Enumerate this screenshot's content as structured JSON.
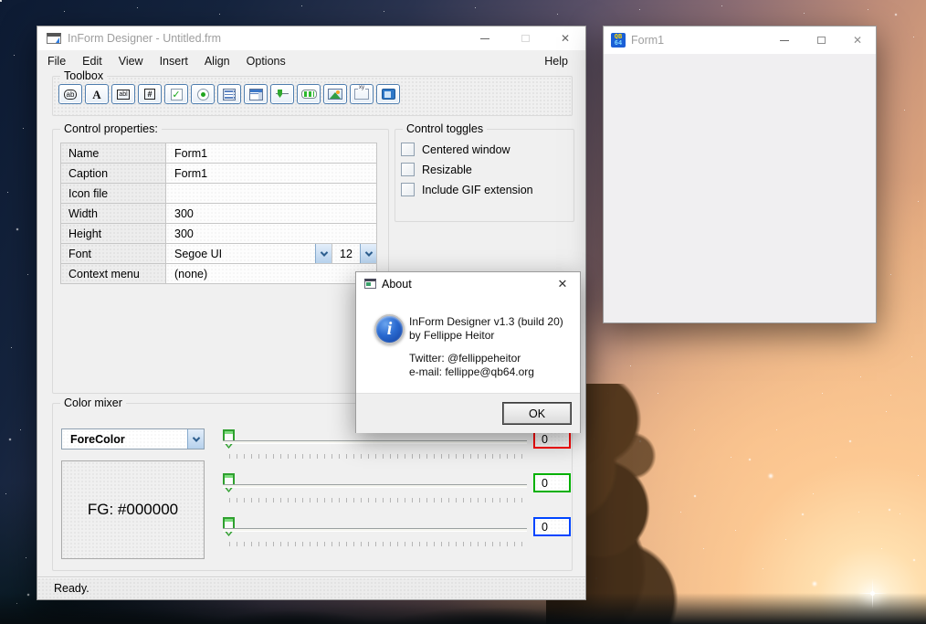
{
  "glyphs": {
    "close": "✕",
    "check": "✓"
  },
  "main_window": {
    "title": "InForm Designer - Untitled.frm",
    "menu": {
      "items": [
        {
          "label": "File"
        },
        {
          "label": "Edit"
        },
        {
          "label": "View"
        },
        {
          "label": "Insert"
        },
        {
          "label": "Align"
        },
        {
          "label": "Options"
        }
      ],
      "help": "Help"
    },
    "toolbox": {
      "legend": "Toolbox",
      "tools": [
        {
          "name": "command-button",
          "glyph": "ab"
        },
        {
          "name": "label",
          "glyph": "A"
        },
        {
          "name": "textbox",
          "glyph": "abl"
        },
        {
          "name": "numeric-textbox",
          "glyph": "#"
        },
        {
          "name": "checkbox"
        },
        {
          "name": "radio-button"
        },
        {
          "name": "list-box"
        },
        {
          "name": "dropdown-list"
        },
        {
          "name": "track-bar"
        },
        {
          "name": "progress-bar"
        },
        {
          "name": "picture-box"
        },
        {
          "name": "frame",
          "glyph": "xy"
        },
        {
          "name": "container"
        }
      ]
    },
    "properties": {
      "legend": "Control properties:",
      "rows": [
        {
          "label": "Name",
          "value": "Form1"
        },
        {
          "label": "Caption",
          "value": "Form1"
        },
        {
          "label": "Icon file",
          "value": ""
        },
        {
          "label": "Width",
          "value": "300"
        },
        {
          "label": "Height",
          "value": "300"
        }
      ],
      "font_row": {
        "label": "Font",
        "font_name": "Segoe UI",
        "font_size": "12"
      },
      "context_row": {
        "label": "Context menu",
        "value": "(none)"
      }
    },
    "toggles": {
      "legend": "Control toggles",
      "items": [
        {
          "label": "Centered window",
          "checked": false
        },
        {
          "label": "Resizable",
          "checked": false
        },
        {
          "label": "Include GIF extension",
          "checked": false
        }
      ]
    },
    "color_mixer": {
      "legend": "Color mixer",
      "selected_channel": "ForeColor",
      "preview": "FG: #000000",
      "sliders": [
        {
          "channel": "red",
          "value": "0",
          "box_border": "#ff0000"
        },
        {
          "channel": "green",
          "value": "0",
          "box_border": "#00b000"
        },
        {
          "channel": "blue",
          "value": "0",
          "box_border": "#0045ff"
        }
      ]
    },
    "status": "Ready."
  },
  "about_dialog": {
    "title": "About",
    "lines": [
      "InForm Designer v1.3 (build 20)",
      "by Fellippe Heitor",
      "Twitter: @fellippeheitor",
      "e-mail: fellippe@qb64.org"
    ],
    "ok_label": "OK"
  },
  "form_window": {
    "title": "Form1",
    "icon_top": "QB",
    "icon_bottom": "64"
  }
}
